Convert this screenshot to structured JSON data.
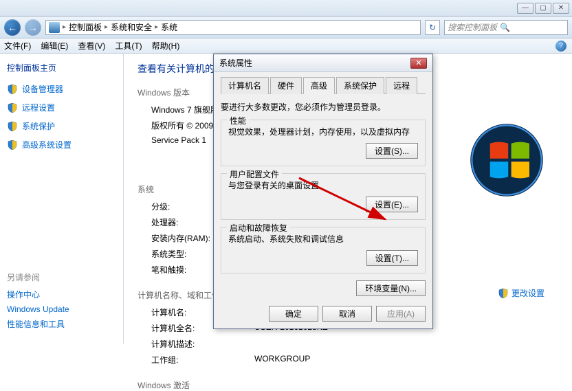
{
  "titlebar": {
    "min": "—",
    "max": "▢",
    "close": "✕"
  },
  "nav": {
    "back": "←",
    "fwd": "→",
    "breadcrumb": [
      "控制面板",
      "系统和安全",
      "系统"
    ],
    "refresh": "↻",
    "search_placeholder": "搜索控制面板",
    "search_icon": "🔍"
  },
  "menu": {
    "items": [
      "文件(F)",
      "编辑(E)",
      "查看(V)",
      "工具(T)",
      "帮助(H)"
    ],
    "help": "?"
  },
  "sidebar": {
    "title": "控制面板主页",
    "links": [
      {
        "icon": "🛡",
        "label": "设备管理器"
      },
      {
        "icon": "🛡",
        "label": "远程设置"
      },
      {
        "icon": "🛡",
        "label": "系统保护"
      },
      {
        "icon": "🛡",
        "label": "高级系统设置"
      }
    ],
    "see_also_title": "另请参阅",
    "see_also": [
      "操作中心",
      "Windows Update",
      "性能信息和工具"
    ]
  },
  "content": {
    "heading": "查看有关计算机的基本信息",
    "edition_label": "Windows 版本",
    "edition": "Windows 7 旗舰版",
    "copyright": "版权所有 © 2009 Microsoft Corporation。保留所有权利。",
    "sp": "Service Pack 1",
    "system_label": "系统",
    "rows": [
      {
        "label": "分级:",
        "value": ""
      },
      {
        "label": "处理器:",
        "value": ""
      },
      {
        "label": "安装内存(RAM):",
        "value": ""
      },
      {
        "label": "系统类型:",
        "value": ""
      },
      {
        "label": "笔和触摸:",
        "value": ""
      }
    ],
    "domain_label": "计算机名称、域和工作组设置",
    "domain_rows": [
      {
        "label": "计算机名:",
        "value": ""
      },
      {
        "label": "计算机全名:",
        "value": "USER-20161028NZ"
      },
      {
        "label": "计算机描述:",
        "value": ""
      },
      {
        "label": "工作组:",
        "value": "WORKGROUP"
      }
    ],
    "activation_label": "Windows 激活",
    "change_settings": "更改设置"
  },
  "dialog": {
    "title": "系统属性",
    "close": "✕",
    "tabs": [
      "计算机名",
      "硬件",
      "高级",
      "系统保护",
      "远程"
    ],
    "active_tab": 2,
    "note": "要进行大多数更改，您必须作为管理员登录。",
    "groups": [
      {
        "title": "性能",
        "text": "视觉效果，处理器计划，内存使用，以及虚拟内存",
        "button": "设置(S)..."
      },
      {
        "title": "用户配置文件",
        "text": "与您登录有关的桌面设置",
        "button": "设置(E)..."
      },
      {
        "title": "启动和故障恢复",
        "text": "系统启动、系统失败和调试信息",
        "button": "设置(T)..."
      }
    ],
    "env_button": "环境变量(N)...",
    "footer": {
      "ok": "确定",
      "cancel": "取消",
      "apply": "应用(A)"
    }
  }
}
